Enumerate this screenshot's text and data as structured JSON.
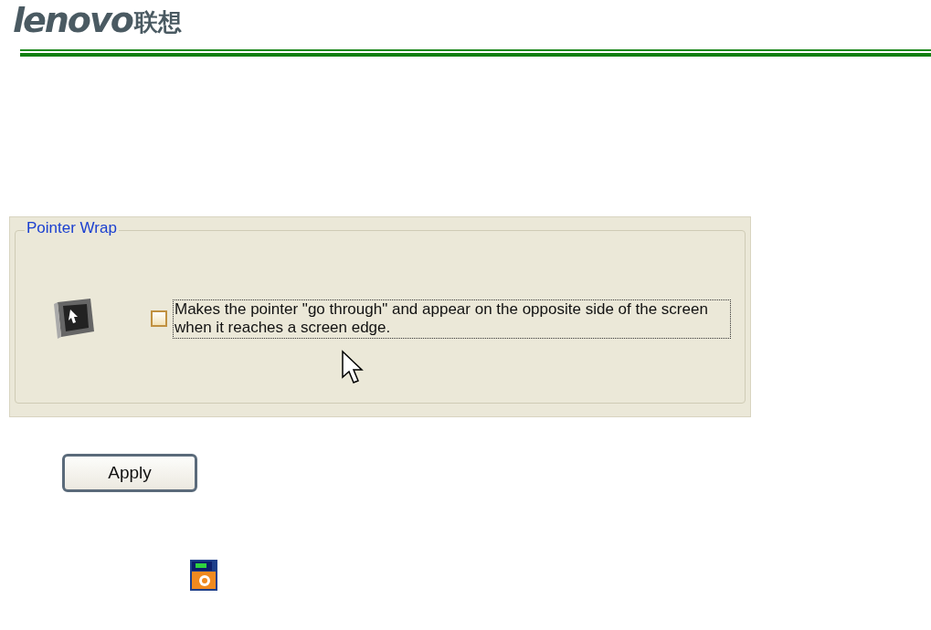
{
  "header": {
    "logo": "lenovo",
    "logo_cn": "联想"
  },
  "group": {
    "title": "Pointer Wrap",
    "option": {
      "checked": false,
      "label": "Makes the pointer \"go through\" and appear on the opposite side of the screen when it reaches a screen edge."
    }
  },
  "buttons": [
    "Apply"
  ]
}
